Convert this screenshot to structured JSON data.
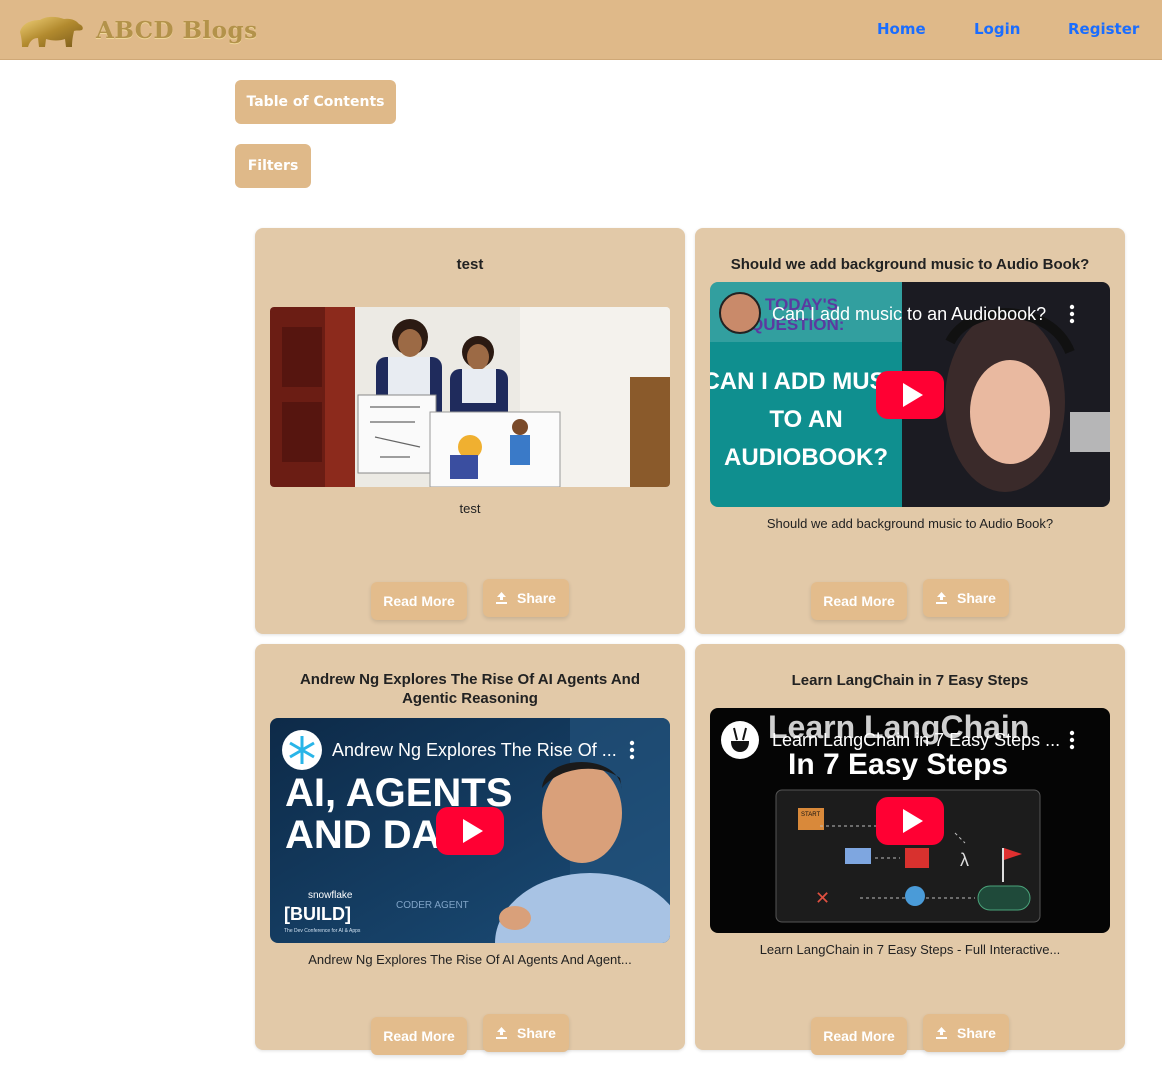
{
  "nav": {
    "brand": "ABCD Blogs",
    "links": [
      "Home",
      "Login",
      "Register"
    ]
  },
  "toolbar": {
    "toc_label": "Table of Contents",
    "filters_label": "Filters"
  },
  "posts": [
    {
      "title": "test",
      "media_type": "image",
      "description": "test",
      "read_more": "Read More",
      "share": "Share"
    },
    {
      "title": "Should we add background music to Audio Book?",
      "media_type": "video",
      "video_title": "Can I add music to an Audiobook?",
      "thumb_text": [
        "TODAY'S",
        "QUESTION:",
        "CAN I ADD MUSIC",
        "TO AN",
        "AUDIOBOOK?"
      ],
      "description": "Should we add background music to Audio Book?",
      "read_more": "Read More",
      "share": "Share"
    },
    {
      "title": "Andrew Ng Explores The Rise Of AI Agents And Agentic Reasoning",
      "media_type": "video",
      "video_title": "Andrew Ng Explores The Rise Of ...",
      "thumb_text": [
        "AI, AGENTS",
        "AND DA",
        "snowflake",
        "[BUILD]",
        "The Dev Conference for AI & Apps",
        "CODER AGENT"
      ],
      "description": "Andrew Ng Explores The Rise Of AI Agents And Agent...",
      "read_more": "Read More",
      "share": "Share"
    },
    {
      "title": "Learn LangChain in 7 Easy Steps",
      "media_type": "video",
      "video_title": "Learn LangChain in 7 Easy Steps ...",
      "thumb_text": [
        "Learn LangChain",
        "In 7 Easy Steps",
        "START"
      ],
      "description": "Learn LangChain in 7 Easy Steps - Full Interactive...",
      "read_more": "Read More",
      "share": "Share"
    }
  ],
  "colors": {
    "navbar": "#dfb989",
    "card": "#e2c9a8",
    "button": "#e3bc8c",
    "link": "#1a6dff",
    "youtube_red": "#ff0033"
  },
  "icons": [
    "bear-logo-icon",
    "share-upload-icon",
    "youtube-play-icon",
    "kebab-menu-icon"
  ]
}
